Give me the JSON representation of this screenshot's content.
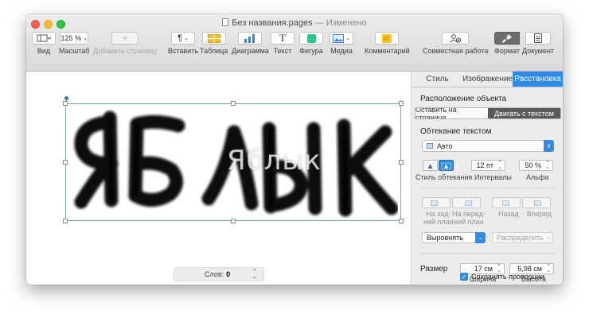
{
  "window": {
    "title": "Без названия.pages",
    "title_sep": " — ",
    "status": "Изменено"
  },
  "toolbar": {
    "view_label": "Вид",
    "zoom_value": "125 %",
    "zoom_label": "Масштаб",
    "add_page_label": "Добавить страницу",
    "insert_label": "Вставить",
    "table_label": "Таблица",
    "chart_label": "Диаграмма",
    "text_label": "Текст",
    "shape_label": "Фигура",
    "media_label": "Медиа",
    "comment_label": "Комментарий",
    "collab_label": "Совместная работа",
    "format_label": "Формат",
    "document_label": "Документ"
  },
  "canvas": {
    "watermark": "Яблык",
    "word_count_label": "Слов:",
    "word_count_value": "0"
  },
  "panel": {
    "tabs": [
      "Стиль",
      "Изображение",
      "Расстановка"
    ],
    "active_tab": "Расстановка",
    "placement_heading": "Расположение объекта",
    "placement_options": [
      "Оставить на странице",
      "Двигать с текстом"
    ],
    "wrap_heading": "Обтекание текстом",
    "wrap_value": "Авто",
    "spacing_value": "12 пт",
    "alpha_value": "50 %",
    "wrap_style_label": "Стиль обтекания",
    "spacing_label": "Интервалы",
    "alpha_label": "Альфа",
    "layer_back_label": "На зад-\nний план",
    "layer_front_label": "На перед-\nний план",
    "backward_label": "Назад",
    "forward_label": "Вперед",
    "align_label": "Выровнять",
    "distribute_label": "Распределить",
    "size_label": "Размер",
    "width_value": "17 см",
    "height_value": "5,98 см",
    "width_label": "Ширина",
    "height_label": "Высота",
    "keep_ratio_label": "Сохранять пропорции",
    "keep_ratio_checked": true
  },
  "colors": {
    "accent": "#2e8be8",
    "selection": "#7aa4d8"
  }
}
